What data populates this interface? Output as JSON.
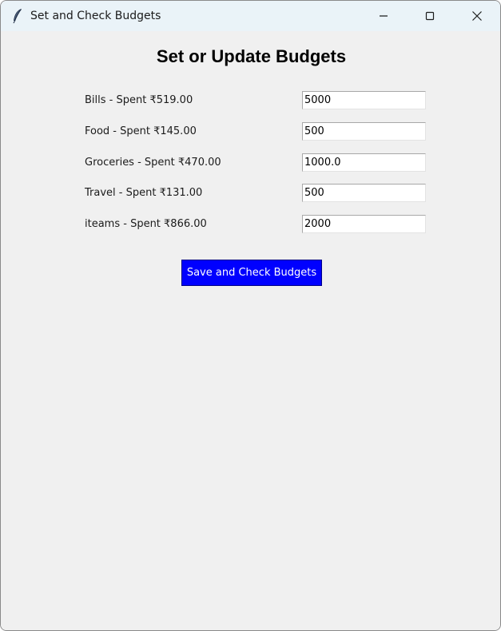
{
  "window": {
    "title": "Set and Check Budgets",
    "icon": "feather-icon",
    "controls": [
      "minimize-icon",
      "maximize-icon",
      "close-icon"
    ]
  },
  "heading": "Set or Update Budgets",
  "budgets": [
    {
      "label": "Bills - Spent ₹519.00",
      "value": "5000"
    },
    {
      "label": "Food - Spent ₹145.00",
      "value": "500"
    },
    {
      "label": "Groceries - Spent ₹470.00",
      "value": "1000.0"
    },
    {
      "label": "Travel - Spent ₹131.00",
      "value": "500"
    },
    {
      "label": "iteams - Spent ₹866.00",
      "value": "2000"
    }
  ],
  "save_button_label": "Save and Check Budgets",
  "colors": {
    "background": "#f0f0f0",
    "titlebar": "#eaf3f8",
    "button_bg": "#0000ff",
    "button_text": "#ffffff"
  }
}
